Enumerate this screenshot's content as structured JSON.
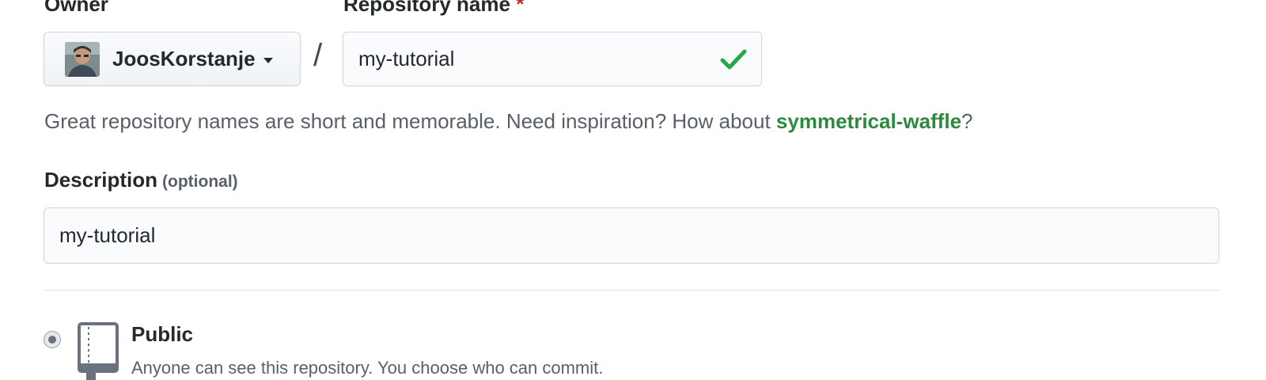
{
  "owner": {
    "label": "Owner",
    "name": "JoosKorstanje",
    "avatar_icon": "user-avatar"
  },
  "separator": "/",
  "repository": {
    "label": "Repository name",
    "required_marker": "*",
    "value": "my-tutorial",
    "valid_icon": "check-icon",
    "valid_color": "#28a745"
  },
  "hint": {
    "text_before": "Great repository names are short and memorable. Need inspiration? How about ",
    "suggestion": "symmetrical-waffle",
    "text_after": "?"
  },
  "description": {
    "label": "Description",
    "optional_label": "(optional)",
    "value": "my-tutorial"
  },
  "visibility": {
    "options": [
      {
        "title": "Public",
        "description": "Anyone can see this repository. You choose who can commit.",
        "icon": "repo-icon",
        "selected": true
      }
    ]
  }
}
